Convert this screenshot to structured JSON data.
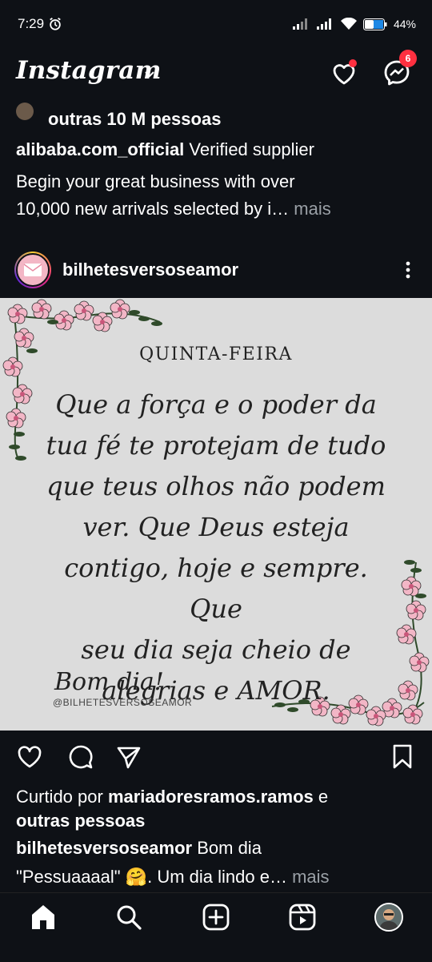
{
  "status_bar": {
    "time": "7:29",
    "battery": "44%",
    "icons": [
      "alarm-icon",
      "signal-icon",
      "signal-icon",
      "wifi-icon",
      "battery-icon"
    ]
  },
  "header": {
    "brand": "Instagram",
    "messages_badge": "6",
    "icons": [
      "chevron-down-icon",
      "heart-icon",
      "messenger-icon"
    ]
  },
  "prev_post": {
    "liked_by_rest": "outras 10 M pessoas",
    "username": "alibaba.com_official",
    "caption_1": " Verified supplier",
    "caption_2": "Begin your great business with over",
    "caption_3": "10,000 new arrivals selected by i…",
    "more": " mais"
  },
  "post": {
    "username": "bilhetesversoseamor",
    "image": {
      "day": "QUINTA-FEIRA",
      "quote_lines": [
        "Que a força e o poder da",
        "tua fé te protejam de tudo",
        "que teus olhos não podem",
        "ver. Que Deus esteja",
        "contigo, hoje e sempre. Que",
        "seu dia seja cheio de",
        "alegrias e AMOR."
      ],
      "signature": "Bom dia!",
      "handle": "@BILHETESVERSOSEAMOR"
    },
    "liked_prefix": "Curtido por ",
    "liked_user": "mariadoresramos.ramos",
    "liked_suffix": " e",
    "liked_line2": "outras pessoas",
    "caption_user": "bilhetesversoseamor",
    "caption_1": " Bom dia",
    "caption_2": "\"Pessuaaaal\" 🤗. Um dia lindo e…",
    "more": " mais"
  },
  "colors": {
    "background": "#0e1116",
    "accent_red": "#ff3040",
    "muted": "#9aa0a6",
    "image_bg": "#dcdcdc"
  }
}
